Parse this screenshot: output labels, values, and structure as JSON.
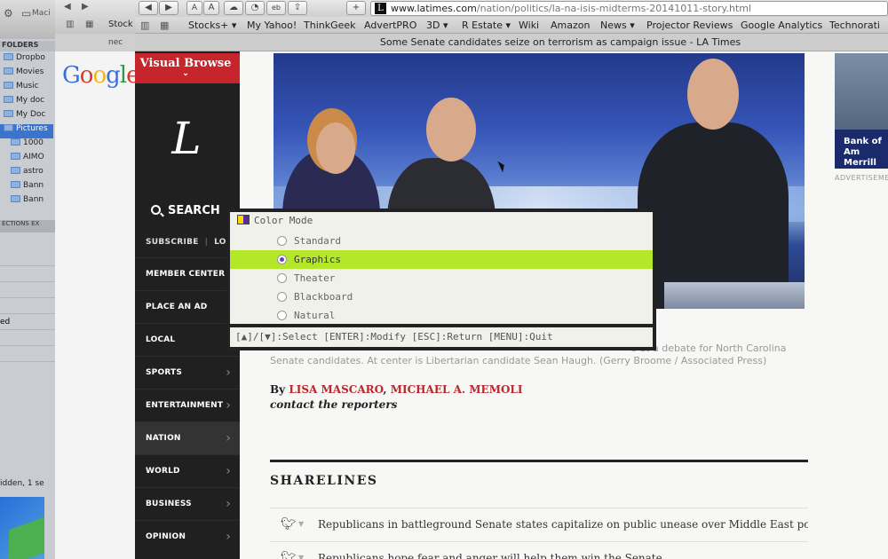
{
  "finder": {
    "toolbar_label": "Maci",
    "folders_header": "FOLDERS",
    "items": [
      "Dropbo",
      "Movies",
      "Music",
      "My doc",
      "My Doc",
      "Pictures",
      "1000",
      "AIMO",
      "astro",
      "Bann",
      "Bann"
    ],
    "selected_index": 5,
    "actions_label": "ECTIONS",
    "actions_label2": "EX",
    "row_label": "ed",
    "status": "idden, 1 se"
  },
  "bg_browser": {
    "tab_label": "nec",
    "bookmark": "Stock",
    "google_logo": "Google"
  },
  "browser": {
    "url_domain": "www.latimes.com",
    "url_path": "/nation/politics/la-na-isis-midterms-20141011-story.html",
    "bookmarks": [
      "Stocks+ ▾",
      "My Yahoo!",
      "ThinkGeek",
      "AdvertPRO",
      "3D ▾",
      "R Estate ▾",
      "Wiki",
      "Amazon",
      "News ▾",
      "Projector Reviews",
      "Google Analytics",
      "Technorati"
    ],
    "tab_title": "Some Senate candidates seize on terrorism as campaign issue - LA Times"
  },
  "sidebar": {
    "visual_browse": "Visual Browse",
    "logo": "L",
    "search": "SEARCH",
    "subscribe": "SUBSCRIBE",
    "login": "LOG IN",
    "nav": [
      {
        "label": "MEMBER CENTER",
        "arrow": ""
      },
      {
        "label": "PLACE AN AD",
        "arrow": ""
      },
      {
        "label": "LOCAL",
        "arrow": "›"
      },
      {
        "label": "SPORTS",
        "arrow": "›"
      },
      {
        "label": "ENTERTAINMENT",
        "arrow": "›"
      },
      {
        "label": "NATION",
        "arrow": "›"
      },
      {
        "label": "WORLD",
        "arrow": "›"
      },
      {
        "label": "BUSINESS",
        "arrow": "›"
      },
      {
        "label": "OPINION",
        "arrow": "›"
      }
    ]
  },
  "article": {
    "caption_right": "d at a debate for North Carolina",
    "caption": "Senate candidates. At center is Libertarian candidate Sean Haugh. (Gerry Broome / Associated Press)",
    "by": "By",
    "author1": "LISA MASCARO",
    "author2": "MICHAEL A. MEMOLI",
    "contact": "contact the reporters",
    "sharelines_heading": "SHARELINES",
    "sharelines": [
      "Republicans in battleground Senate states capitalize on public unease over Middle East policy",
      "Republicans hope fear and anger will help them win the Senate"
    ]
  },
  "ad": {
    "text": "Bank of Am Merrill Ly",
    "label": "ADVERTISEMENT"
  },
  "osd": {
    "title": "Color Mode",
    "options": [
      "Standard",
      "Graphics",
      "Theater",
      "Blackboard",
      "Natural"
    ],
    "selected": "Graphics",
    "help": "[▲]/[▼]:Select [ENTER]:Modify [ESC]:Return [MENU]:Quit"
  }
}
